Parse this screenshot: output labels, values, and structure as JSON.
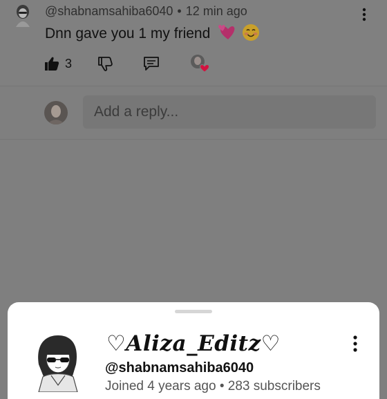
{
  "comment": {
    "handle": "@shabnamsahiba6040",
    "separator": "•",
    "time": "12 min ago",
    "text": "Dnn gave you 1 my friend",
    "like_count": "3"
  },
  "reply": {
    "placeholder": "Add a reply..."
  },
  "sheet": {
    "channel_name": "♡Aliza_Editz♡",
    "handle": "@shabnamsahiba6040",
    "joined": "Joined 4 years ago • 283 subscribers"
  },
  "icons": {
    "like": "thumbs-up-icon",
    "dislike": "thumbs-down-icon",
    "reply": "comment-icon",
    "heart_badge": "creator-heart-icon",
    "more": "more-vert-icon"
  },
  "colors": {
    "overlay": "#7f7f7f",
    "sheet": "#ffffff",
    "heart": "#d3123f"
  }
}
